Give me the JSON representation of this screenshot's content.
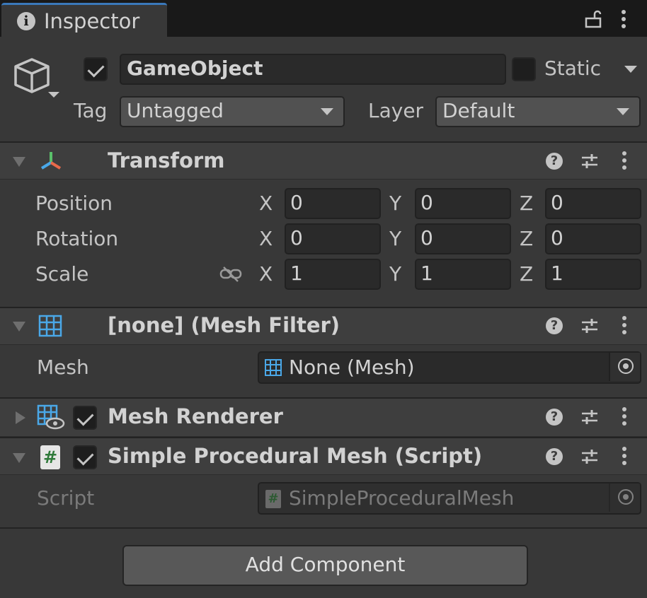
{
  "window": {
    "tab_title": "Inspector"
  },
  "header": {
    "object_name": "GameObject",
    "active_checked": true,
    "static_label": "Static",
    "static_checked": false,
    "tag_label": "Tag",
    "tag_value": "Untagged",
    "layer_label": "Layer",
    "layer_value": "Default"
  },
  "components": {
    "transform": {
      "title": "Transform",
      "rows": [
        {
          "label": "Position",
          "x": "0",
          "y": "0",
          "z": "0"
        },
        {
          "label": "Rotation",
          "x": "0",
          "y": "0",
          "z": "0"
        },
        {
          "label": "Scale",
          "x": "1",
          "y": "1",
          "z": "1"
        }
      ],
      "axis_labels": {
        "x": "X",
        "y": "Y",
        "z": "Z"
      }
    },
    "mesh_filter": {
      "title": "[none] (Mesh Filter)",
      "mesh_label": "Mesh",
      "mesh_value": "None (Mesh)"
    },
    "mesh_renderer": {
      "title": "Mesh Renderer",
      "enabled": true,
      "expanded": false
    },
    "script": {
      "title": "Simple Procedural Mesh (Script)",
      "enabled": true,
      "script_label": "Script",
      "script_value": "SimpleProceduralMesh",
      "script_icon_text": "#"
    }
  },
  "actions": {
    "add_component_label": "Add Component"
  },
  "colors": {
    "tab_accent": "#3a79bb",
    "background": "#383838",
    "header_bg": "#3e3e3e"
  }
}
